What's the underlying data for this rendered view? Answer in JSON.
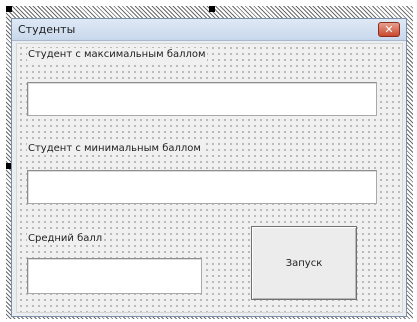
{
  "form": {
    "title": "Студенты",
    "close_glyph": "✕"
  },
  "controls": {
    "label1": "Студент с максимальным баллом",
    "textbox1_value": "",
    "label2": "Студент с минимальным баллом",
    "textbox2_value": "",
    "label3": "Средний балл",
    "textbox3_value": "",
    "run_button": "Запуск"
  }
}
